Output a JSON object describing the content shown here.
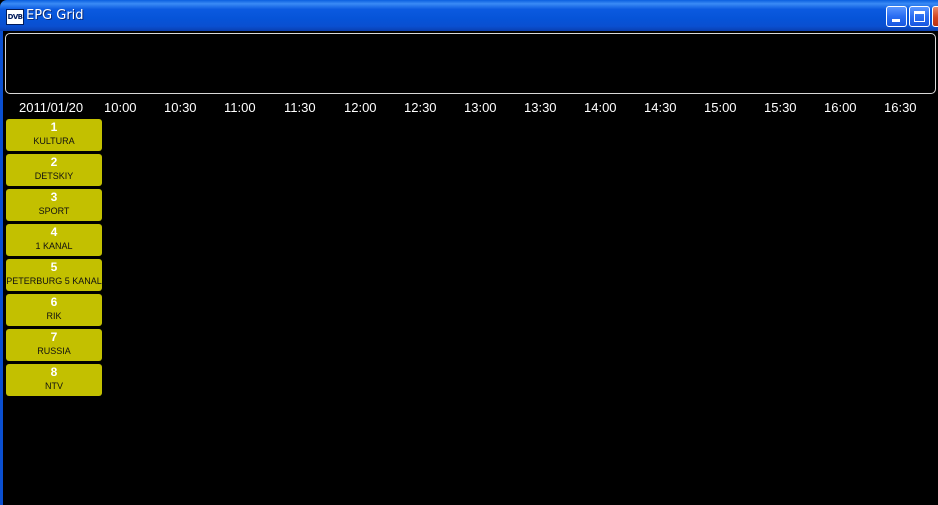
{
  "window": {
    "title": "EPG Grid",
    "icon_text": "DVB",
    "icon": "dvb-app-icon",
    "accent_color": "#0a55d8",
    "close_color": "#d2431f"
  },
  "info_panel": {
    "text": ""
  },
  "timeline": {
    "date": "2011/01/20",
    "times": [
      "10:00",
      "10:30",
      "11:00",
      "11:30",
      "12:00",
      "12:30",
      "13:00",
      "13:30",
      "14:00",
      "14:30",
      "15:00",
      "15:30",
      "16:00",
      "16:30"
    ]
  },
  "channels": [
    {
      "number": "1",
      "name": "KULTURA"
    },
    {
      "number": "2",
      "name": "DETSKIY"
    },
    {
      "number": "3",
      "name": "SPORT"
    },
    {
      "number": "4",
      "name": "1 KANAL"
    },
    {
      "number": "5",
      "name": "PETERBURG 5 KANAL"
    },
    {
      "number": "6",
      "name": "RIK"
    },
    {
      "number": "7",
      "name": "RUSSIA"
    },
    {
      "number": "8",
      "name": "NTV"
    }
  ],
  "colors": {
    "background": "#000000",
    "channel_button": "#c3c000",
    "timeline_text": "#ffffff"
  }
}
